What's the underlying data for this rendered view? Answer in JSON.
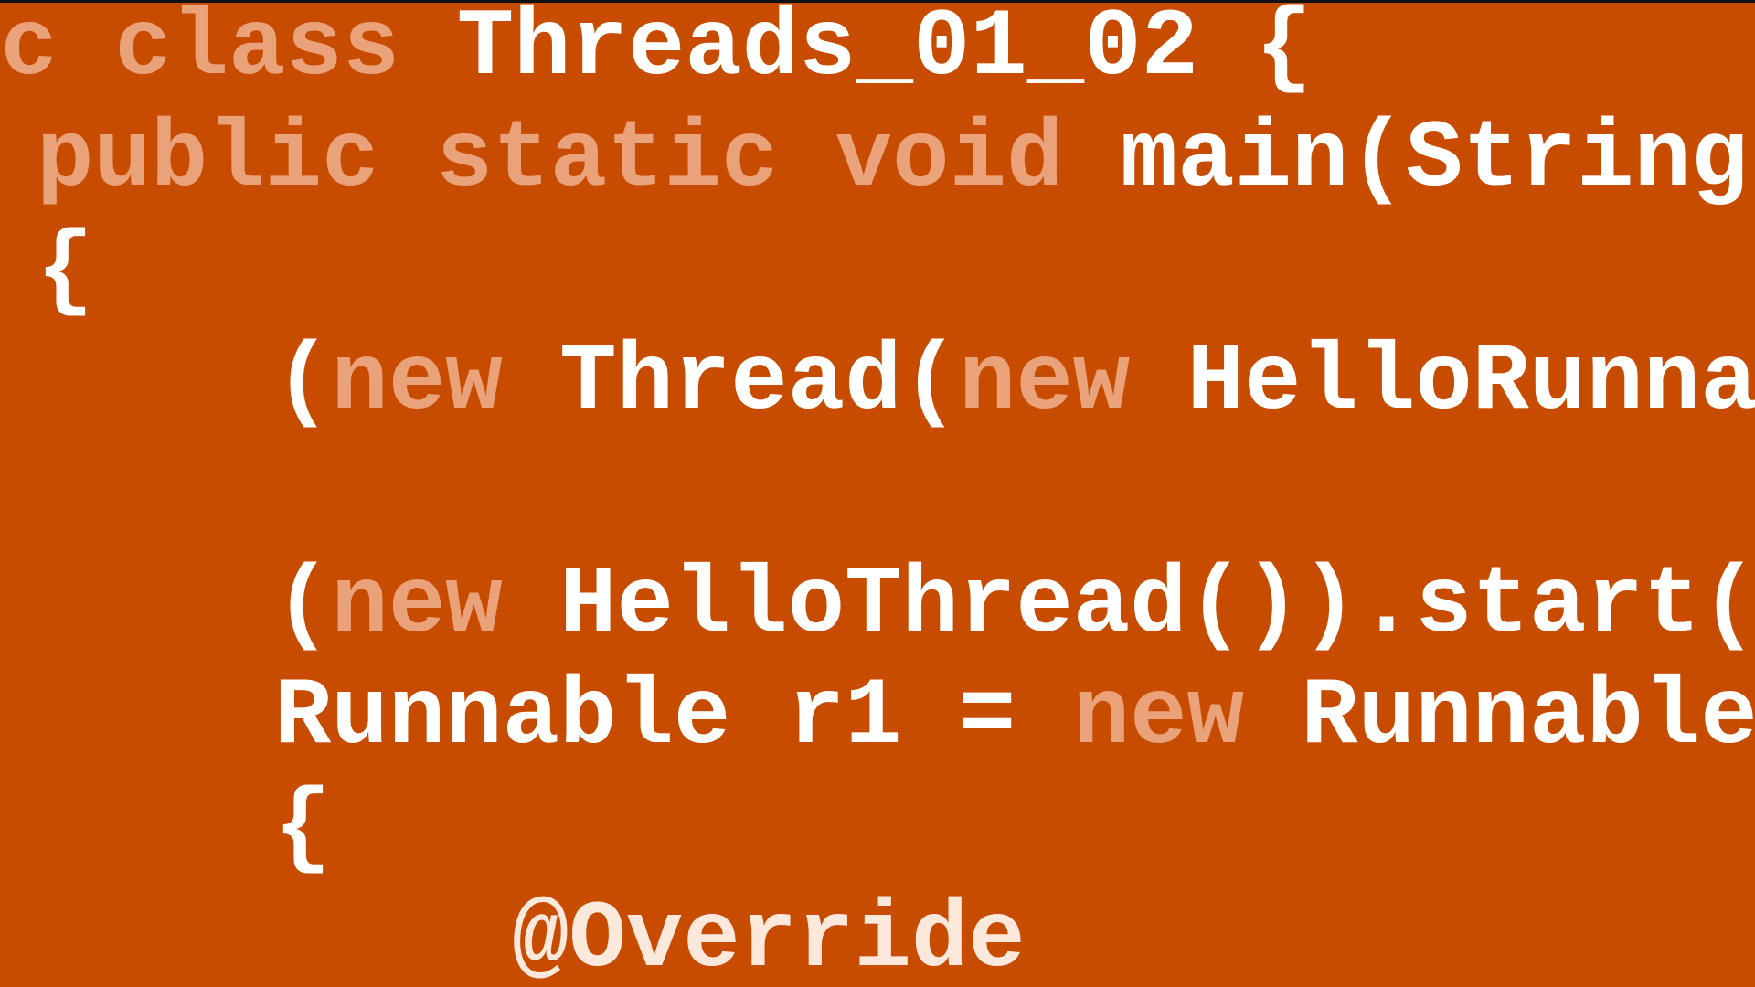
{
  "colors": {
    "background": "#c84c00",
    "keyword": "#eaa27a",
    "identifier": "#ffffff",
    "annotation": "#fde8dc"
  },
  "code": {
    "line1": {
      "kw": "ic class",
      "id": " Threads_01_02 {"
    },
    "line2": {
      "kw": "public static void",
      "id": " main(String"
    },
    "line3": {
      "id": "{"
    },
    "line4": {
      "p1": "(",
      "kw1": "new",
      "p2": " Thread(",
      "kw2": "new",
      "p3": " HelloRunna"
    },
    "line5": {
      "p1": "(",
      "kw1": "new",
      "p2": " HelloThread()).start("
    },
    "line6": {
      "p1": "Runnable r1 = ",
      "kw1": "new",
      "p2": " Runnable"
    },
    "line7": {
      "id": "{"
    },
    "line8": {
      "ann": "@Override"
    }
  }
}
